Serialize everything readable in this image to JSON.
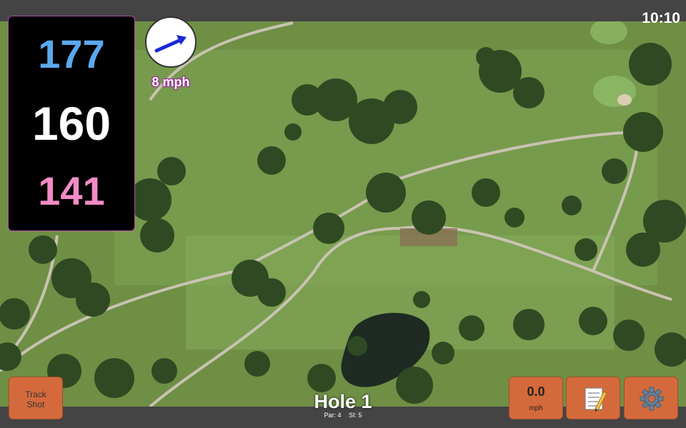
{
  "status": {
    "time": "10:10"
  },
  "distances": {
    "back": "177",
    "middle": "160",
    "front": "141"
  },
  "wind": {
    "speed_label": "8 mph",
    "icon": "wind-arrow-icon"
  },
  "hole": {
    "title": "Hole 1",
    "par_label": "Par: 4",
    "si_label": "SI: 5"
  },
  "buttons": {
    "track_shot_line1": "Track",
    "track_shot_line2": "Shot",
    "speed_value": "0.0",
    "speed_unit": "mph",
    "notes_icon": "notepad-icon",
    "settings_icon": "gear-icon"
  },
  "colors": {
    "back_distance": "#5aa8ee",
    "middle_distance": "#ffffff",
    "front_distance": "#f58bc6",
    "button_bg": "#d46a3c",
    "panel_border": "#b04aa8"
  }
}
